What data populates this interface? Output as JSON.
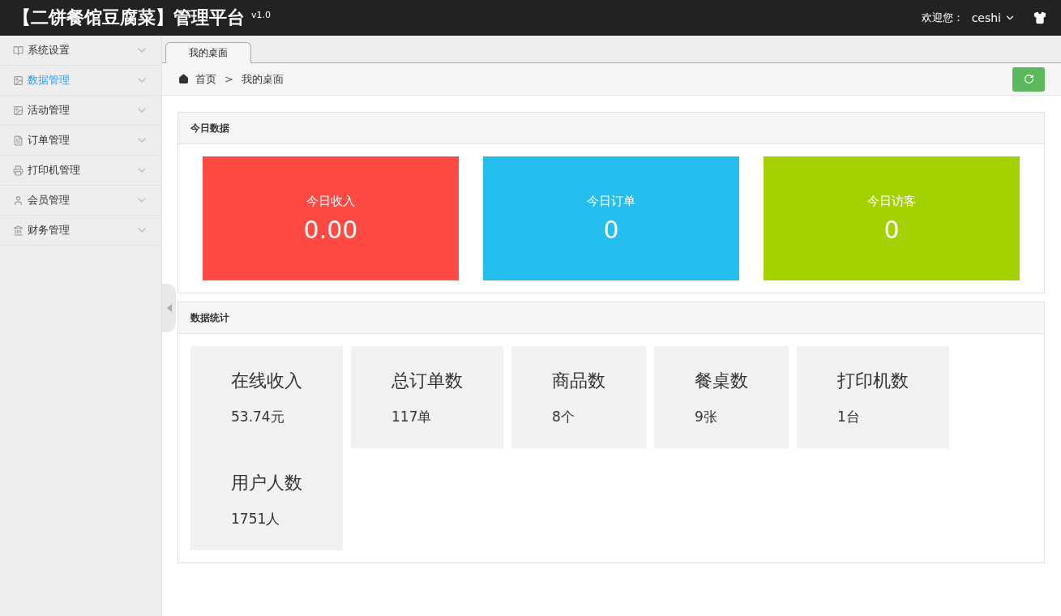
{
  "header": {
    "title": "【二饼餐馆豆腐菜】管理平台",
    "version": "v1.0",
    "welcome": "欢迎您：",
    "user": "ceshi"
  },
  "sidebar": {
    "items": [
      {
        "label": "系统设置",
        "kind": "book",
        "selected": false
      },
      {
        "label": "数据管理",
        "kind": "image",
        "selected": true
      },
      {
        "label": "活动管理",
        "kind": "image",
        "selected": false
      },
      {
        "label": "订单管理",
        "kind": "list",
        "selected": false
      },
      {
        "label": "打印机管理",
        "kind": "printer",
        "selected": false
      },
      {
        "label": "会员管理",
        "kind": "user",
        "selected": false
      },
      {
        "label": "财务管理",
        "kind": "bank",
        "selected": false
      }
    ]
  },
  "tabs": [
    {
      "label": "我的桌面",
      "selected": true
    }
  ],
  "breadcrumb": [
    "首页",
    "我的桌面"
  ],
  "breadcrumb_separator": ">",
  "today_panel": {
    "title": "今日数据",
    "cards": [
      {
        "label": "今日收入",
        "value": "0.00",
        "color": "#ff4a44"
      },
      {
        "label": "今日订单",
        "value": "0",
        "color": "#23bdee"
      },
      {
        "label": "今日访客",
        "value": "0",
        "color": "#a3d200"
      }
    ]
  },
  "stats_panel": {
    "title": "数据统计",
    "tiles": [
      {
        "label": "在线收入",
        "value": "53.74元"
      },
      {
        "label": "总订单数",
        "value": "117单"
      },
      {
        "label": "商品数",
        "value": "8个"
      },
      {
        "label": "餐桌数",
        "value": "9张"
      },
      {
        "label": "打印机数",
        "value": "1台"
      },
      {
        "label": "用户人数",
        "value": "1751人"
      }
    ]
  }
}
